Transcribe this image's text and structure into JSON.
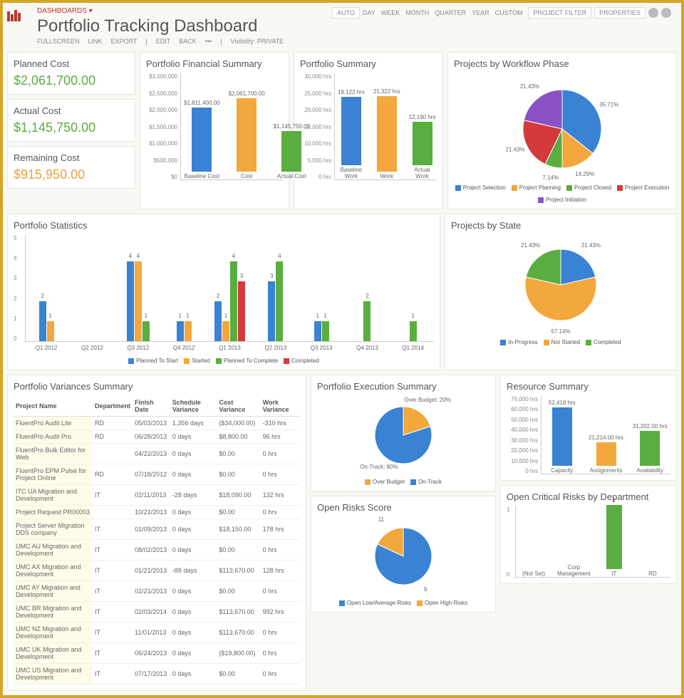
{
  "breadcrumb": "DASHBOARDS ▾",
  "title": "Portfolio Tracking Dashboard",
  "subtoolbar": [
    "FULLSCREEN",
    "LINK",
    "EXPORT",
    "|",
    "EDIT",
    "BACK",
    "•••",
    "|"
  ],
  "visibility_label": "Visibility: PRIVATE",
  "top_tabs": [
    "AUTO",
    "DAY",
    "WEEK",
    "MONTH",
    "QUARTER",
    "YEAR",
    "CUSTOM"
  ],
  "top_buttons": {
    "filter": "PROJECT FILTER",
    "properties": "PROPERTIES"
  },
  "kpis": {
    "planned": {
      "label": "Planned Cost",
      "value": "$2,061,700.00"
    },
    "actual": {
      "label": "Actual Cost",
      "value": "$1,145,750.00"
    },
    "remaining": {
      "label": "Remaining Cost",
      "value": "$915,950.00"
    }
  },
  "fin_summary": {
    "title": "Portfolio Financial Summary",
    "yaxis": [
      "$3,000,000",
      "$2,500,000",
      "$2,000,000",
      "$1,500,000",
      "$1,000,000",
      "$500,000",
      "$0"
    ],
    "bars": [
      {
        "label": "Baseline Cost",
        "value_label": "$1,811,400.00",
        "pct": 60,
        "color": "#3a82d4"
      },
      {
        "label": "Cost",
        "value_label": "$2,061,700.00",
        "pct": 69,
        "color": "#f2a83c"
      },
      {
        "label": "Actual Cost",
        "value_label": "$1,145,750.00",
        "pct": 38,
        "color": "#5aad3f"
      }
    ]
  },
  "port_summary": {
    "title": "Portfolio Summary",
    "yaxis": [
      "30,000 hrs",
      "25,000 hrs",
      "20,000 hrs",
      "15,000 hrs",
      "10,000 hrs",
      "5,000 hrs",
      "0 hrs"
    ],
    "bars": [
      {
        "label": "Baseline Work",
        "value_label": "19,122 hrs",
        "pct": 64,
        "color": "#3a82d4"
      },
      {
        "label": "Work",
        "value_label": "21,322 hrs",
        "pct": 71,
        "color": "#f2a83c"
      },
      {
        "label": "Actual Work",
        "value_label": "12,190 hrs",
        "pct": 41,
        "color": "#5aad3f"
      }
    ]
  },
  "workflow": {
    "title": "Projects by Workflow Phase",
    "slices": [
      {
        "name": "Project Selection",
        "pct": 35.71,
        "color": "#3a82d4"
      },
      {
        "name": "Project Planning",
        "pct": 14.29,
        "color": "#f2a83c"
      },
      {
        "name": "Project Closed",
        "pct": 7.14,
        "color": "#5aad3f"
      },
      {
        "name": "Project Execution",
        "pct": 21.43,
        "color": "#d43a3a"
      },
      {
        "name": "Project Initiation",
        "pct": 21.43,
        "color": "#8a52c4"
      }
    ]
  },
  "stats": {
    "title": "Portfolio Statistics",
    "ymax": 5,
    "legend": [
      {
        "name": "Planned To Start",
        "color": "#3a82d4"
      },
      {
        "name": "Started",
        "color": "#f2a83c"
      },
      {
        "name": "Planned To Complete",
        "color": "#5aad3f"
      },
      {
        "name": "Completed",
        "color": "#d43a3a"
      }
    ],
    "groups": [
      {
        "label": "Q1 2012",
        "bars": [
          [
            2,
            "#3a82d4"
          ],
          [
            1,
            "#f2a83c"
          ]
        ]
      },
      {
        "label": "Q2 2012",
        "bars": []
      },
      {
        "label": "Q3 2012",
        "bars": [
          [
            4,
            "#3a82d4"
          ],
          [
            4,
            "#f2a83c"
          ],
          [
            1,
            "#5aad3f"
          ]
        ]
      },
      {
        "label": "Q4 2012",
        "bars": [
          [
            1,
            "#3a82d4"
          ],
          [
            1,
            "#f2a83c"
          ]
        ]
      },
      {
        "label": "Q1 2013",
        "bars": [
          [
            2,
            "#3a82d4"
          ],
          [
            1,
            "#f2a83c"
          ],
          [
            4,
            "#5aad3f"
          ],
          [
            3,
            "#d43a3a"
          ]
        ]
      },
      {
        "label": "Q2 2013",
        "bars": [
          [
            3,
            "#3a82d4"
          ],
          [
            4,
            "#5aad3f"
          ]
        ]
      },
      {
        "label": "Q3 2013",
        "bars": [
          [
            1,
            "#3a82d4"
          ],
          [
            1,
            "#5aad3f"
          ]
        ]
      },
      {
        "label": "Q4 2013",
        "bars": [
          [
            2,
            "#5aad3f"
          ]
        ]
      },
      {
        "label": "Q1 2014",
        "bars": [
          [
            1,
            "#5aad3f"
          ]
        ]
      }
    ]
  },
  "by_state": {
    "title": "Projects by State",
    "slices": [
      {
        "name": "In-Progress",
        "pct": 21.43,
        "color": "#3a82d4"
      },
      {
        "name": "Not Started",
        "pct": 57.14,
        "color": "#f2a83c"
      },
      {
        "name": "Completed",
        "pct": 21.43,
        "color": "#5aad3f"
      }
    ]
  },
  "variances": {
    "title": "Portfolio Variances Summary",
    "headers": [
      "Project Name",
      "Department",
      "Finish Date",
      "Schedule Variance",
      "Cost Variance",
      "Work Variance"
    ],
    "rows": [
      [
        "FluentPro Audit Lite",
        "RD",
        "05/03/2013",
        "1,356 days",
        "($34,000.00)",
        "-310 hrs"
      ],
      [
        "FluentPro Audit Pro",
        "RD",
        "06/28/2013",
        "0 days",
        "$8,800.00",
        "96 hrs"
      ],
      [
        "FluentPro Bulk Editor for Web",
        "",
        "04/22/2013",
        "0 days",
        "$0.00",
        "0 hrs"
      ],
      [
        "FluentPro EPM Pulse for Project Online",
        "RD",
        "07/18/2012",
        "0 days",
        "$0.00",
        "0 hrs"
      ],
      [
        "ITC UA Migration and Development",
        "IT",
        "02/11/2013",
        "-28 days",
        "$18,090.00",
        "132 hrs"
      ],
      [
        "Project Request PR00003",
        "",
        "10/21/2013",
        "0 days",
        "$0.00",
        "0 hrs"
      ],
      [
        "Project Server Migration DDS company",
        "IT",
        "01/09/2013",
        "0 days",
        "$18,150.00",
        "178 hrs"
      ],
      [
        "UMC AU Migration and Development",
        "IT",
        "08/02/2013",
        "0 days",
        "$0.00",
        "0 hrs"
      ],
      [
        "UMC AX Migration and Development",
        "IT",
        "01/21/2013",
        "-88 days",
        "$113,670.00",
        "128 hrs"
      ],
      [
        "UMC AY Migration and Development",
        "IT",
        "02/21/2013",
        "0 days",
        "$0.00",
        "0 hrs"
      ],
      [
        "UMC BR Migration and Development",
        "IT",
        "02/03/2014",
        "0 days",
        "$113,670.00",
        "992 hrs"
      ],
      [
        "UMC NZ Migration and Development",
        "IT",
        "11/01/2013",
        "0 days",
        "$113,670.00",
        "0 hrs"
      ],
      [
        "UMC UK Migration and Development",
        "IT",
        "06/24/2013",
        "0 days",
        "($19,800.00)",
        "0 hrs"
      ],
      [
        "UMC US Migration and Development",
        "IT",
        "07/17/2013",
        "0 days",
        "$0.00",
        "0 hrs"
      ]
    ]
  },
  "exec": {
    "title": "Portfolio Execution Summary",
    "slices": [
      {
        "name": "Over Budget",
        "pct": 20,
        "color": "#f2a83c",
        "label": "Over Budget: 20%"
      },
      {
        "name": "On-Track",
        "pct": 80,
        "color": "#3a82d4",
        "label": "On-Track: 80%"
      }
    ]
  },
  "resource": {
    "title": "Resource Summary",
    "yaxis": [
      "70,000 hrs",
      "60,000 hrs",
      "50,000 hrs",
      "40,000 hrs",
      "30,000 hrs",
      "20,000 hrs",
      "10,000 hrs",
      "0 hrs"
    ],
    "bars": [
      {
        "label": "Capacity",
        "value_label": "52,416 hrs",
        "pct": 75,
        "color": "#3a82d4"
      },
      {
        "label": "Assignments",
        "value_label": "21,214.00 hrs",
        "pct": 30,
        "color": "#f2a83c"
      },
      {
        "label": "Availability",
        "value_label": "31,202.00 hrs",
        "pct": 45,
        "color": "#5aad3f"
      }
    ]
  },
  "risks": {
    "title": "Open Risks Score",
    "slices": [
      {
        "name": "Open Low/Average Risks",
        "pct": 82,
        "color": "#3a82d4",
        "label": "9"
      },
      {
        "name": "Open High Risks",
        "pct": 18,
        "color": "#f2a83c",
        "label": "11"
      }
    ]
  },
  "crit_risks": {
    "title": "Open Critical Risks by Department",
    "ymax": 1,
    "bars": [
      {
        "label": "(Not Set)",
        "value": 0
      },
      {
        "label": "Corp Management",
        "value": 0
      },
      {
        "label": "IT",
        "value": 1
      },
      {
        "label": "RD",
        "value": 0
      }
    ]
  },
  "chart_data": [
    {
      "type": "bar",
      "title": "Portfolio Financial Summary",
      "categories": [
        "Baseline Cost",
        "Cost",
        "Actual Cost"
      ],
      "values": [
        1811400,
        2061700,
        1145750
      ],
      "ylim": [
        0,
        3000000
      ]
    },
    {
      "type": "bar",
      "title": "Portfolio Summary",
      "categories": [
        "Baseline Work",
        "Work",
        "Actual Work"
      ],
      "values": [
        19122,
        21322,
        12190
      ],
      "ylabel": "hrs",
      "ylim": [
        0,
        30000
      ]
    },
    {
      "type": "pie",
      "title": "Projects by Workflow Phase",
      "series": [
        {
          "name": "Project Selection",
          "value": 35.71
        },
        {
          "name": "Project Planning",
          "value": 14.29
        },
        {
          "name": "Project Closed",
          "value": 7.14
        },
        {
          "name": "Project Execution",
          "value": 21.43
        },
        {
          "name": "Project Initiation",
          "value": 21.43
        }
      ]
    },
    {
      "type": "bar",
      "title": "Portfolio Statistics",
      "categories": [
        "Q1 2012",
        "Q2 2012",
        "Q3 2012",
        "Q4 2012",
        "Q1 2013",
        "Q2 2013",
        "Q3 2013",
        "Q4 2013",
        "Q1 2014"
      ],
      "series": [
        {
          "name": "Planned To Start",
          "values": [
            2,
            0,
            4,
            1,
            2,
            3,
            1,
            0,
            0
          ]
        },
        {
          "name": "Started",
          "values": [
            1,
            0,
            4,
            1,
            1,
            0,
            0,
            0,
            0
          ]
        },
        {
          "name": "Planned To Complete",
          "values": [
            0,
            0,
            1,
            0,
            4,
            4,
            1,
            2,
            1
          ]
        },
        {
          "name": "Completed",
          "values": [
            0,
            0,
            0,
            0,
            3,
            0,
            0,
            0,
            0
          ]
        }
      ],
      "ylim": [
        0,
        5
      ]
    },
    {
      "type": "pie",
      "title": "Projects by State",
      "series": [
        {
          "name": "In-Progress",
          "value": 21.43
        },
        {
          "name": "Not Started",
          "value": 57.14
        },
        {
          "name": "Completed",
          "value": 21.43
        }
      ]
    },
    {
      "type": "pie",
      "title": "Portfolio Execution Summary",
      "series": [
        {
          "name": "Over Budget",
          "value": 20
        },
        {
          "name": "On-Track",
          "value": 80
        }
      ]
    },
    {
      "type": "bar",
      "title": "Resource Summary",
      "categories": [
        "Capacity",
        "Assignments",
        "Availability"
      ],
      "values": [
        52416,
        21214,
        31202
      ],
      "ylabel": "hrs",
      "ylim": [
        0,
        70000
      ]
    },
    {
      "type": "pie",
      "title": "Open Risks Score",
      "series": [
        {
          "name": "Open Low/Average Risks",
          "value": 9
        },
        {
          "name": "Open High Risks",
          "value": 11
        }
      ]
    },
    {
      "type": "bar",
      "title": "Open Critical Risks by Department",
      "categories": [
        "(Not Set)",
        "Corp Management",
        "IT",
        "RD"
      ],
      "values": [
        0,
        0,
        1,
        0
      ],
      "ylim": [
        0,
        1
      ]
    }
  ]
}
